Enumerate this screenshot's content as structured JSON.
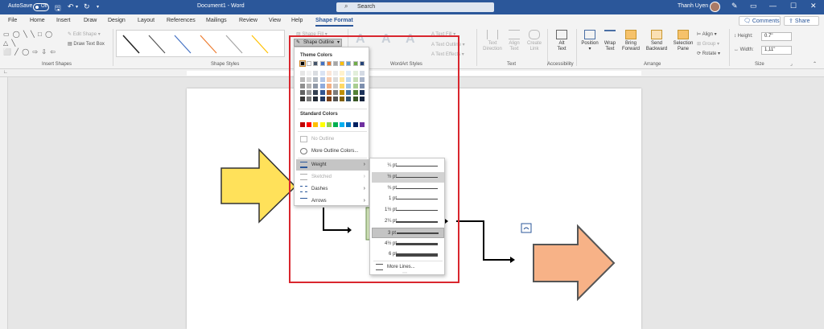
{
  "titlebar": {
    "autosave_label": "AutoSave",
    "autosave_state": "Off",
    "doc_title": "Document1 - Word",
    "search_placeholder": "Search",
    "user_name": "Thanh Uyen"
  },
  "tabs": [
    "File",
    "Home",
    "Insert",
    "Draw",
    "Design",
    "Layout",
    "References",
    "Mailings",
    "Review",
    "View",
    "Help",
    "Shape Format"
  ],
  "active_tab": "Shape Format",
  "top_buttons": {
    "comments": "Comments",
    "share": "Share"
  },
  "ribbon": {
    "insert_shapes": {
      "label": "Insert Shapes",
      "edit_shape": "Edit Shape",
      "draw_text_box": "Draw Text Box"
    },
    "shape_styles": {
      "label": "Shape Styles",
      "shape_fill": "Shape Fill",
      "shape_outline": "Shape Outline"
    },
    "wordart": {
      "label": "WordArt Styles",
      "text_fill": "Text Fill",
      "text_outline": "Text Outline",
      "text_effects": "Text Effects"
    },
    "text": {
      "label": "Text",
      "text_direction": [
        "Text",
        "Direction"
      ],
      "align_text": [
        "Align",
        "Text"
      ],
      "create_link": [
        "Create",
        "Link"
      ]
    },
    "accessibility": {
      "label": "Accessibility",
      "alt_text": [
        "Alt",
        "Text"
      ]
    },
    "arrange": {
      "label": "Arrange",
      "position": "Position",
      "wrap_text": [
        "Wrap",
        "Text"
      ],
      "bring_forward": [
        "Bring",
        "Forward"
      ],
      "send_backward": [
        "Send",
        "Backward"
      ],
      "selection_pane": [
        "Selection",
        "Pane"
      ],
      "align": "Align",
      "group": "Group",
      "rotate": "Rotate"
    },
    "size": {
      "label": "Size",
      "height_label": "Height:",
      "height_value": "0.7\"",
      "width_label": "Width:",
      "width_value": "1,11\""
    }
  },
  "outline_menu": {
    "theme_colors_label": "Theme Colors",
    "standard_colors_label": "Standard Colors",
    "no_outline": "No Outline",
    "more_colors": "More Outline Colors...",
    "weight": "Weight",
    "sketched": "Sketched",
    "dashes": "Dashes",
    "arrows": "Arrows",
    "theme_row": [
      "#000000",
      "#ffffff",
      "#44546a",
      "#4472c4",
      "#ed7d31",
      "#a5a5a5",
      "#ffc000",
      "#5b9bd5",
      "#70ad47",
      "#264478"
    ],
    "standard_row": [
      "#c00000",
      "#ff0000",
      "#ffc000",
      "#ffff00",
      "#92d050",
      "#00b050",
      "#00b0f0",
      "#0070c0",
      "#002060",
      "#7030a0"
    ]
  },
  "weight_menu": {
    "items": [
      "¼ pt",
      "½ pt",
      "¾ pt",
      "1 pt",
      "1½ pt",
      "2¼ pt",
      "3 pt",
      "4½ pt",
      "6 pt"
    ],
    "weights_pt": [
      0.25,
      0.5,
      0.75,
      1,
      1.5,
      2.25,
      3,
      4.5,
      6
    ],
    "hovered": "½ pt",
    "selected": "3 pt",
    "more_lines": "More Lines..."
  },
  "colors": {
    "title_bar": "#2b579a",
    "highlight_box": "#d9262e",
    "yellow_arrow": "#ffe15a",
    "orange_arrow": "#f7b287"
  }
}
